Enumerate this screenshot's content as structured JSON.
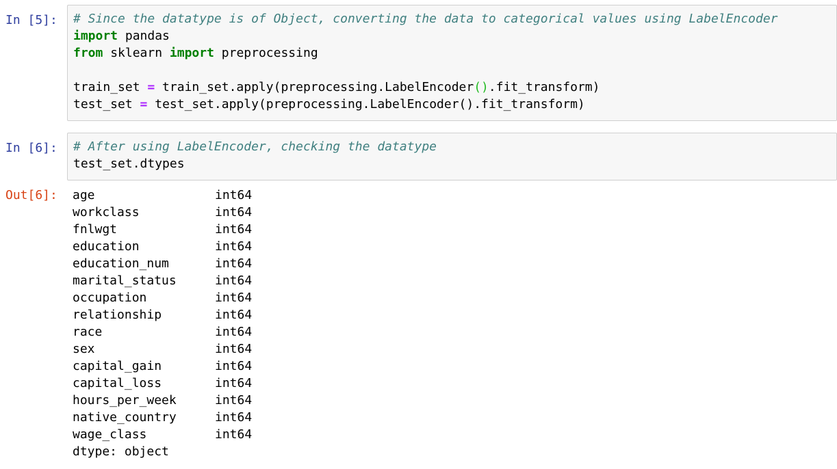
{
  "cells": [
    {
      "prompt": "In [5]:",
      "lines": [
        [
          {
            "t": "cm",
            "v": "# Since the datatype is of Object, converting the data to categorical values using LabelEncoder"
          }
        ],
        [
          {
            "t": "kw",
            "v": "import"
          },
          {
            "t": "",
            "v": " pandas"
          }
        ],
        [
          {
            "t": "kw",
            "v": "from"
          },
          {
            "t": "",
            "v": " sklearn "
          },
          {
            "t": "kw",
            "v": "import"
          },
          {
            "t": "",
            "v": " preprocessing"
          }
        ],
        [
          {
            "t": "",
            "v": ""
          }
        ],
        [
          {
            "t": "",
            "v": "train_set "
          },
          {
            "t": "op",
            "v": "="
          },
          {
            "t": "",
            "v": " train_set.apply(preprocessing.LabelEncoder"
          },
          {
            "t": "paren-match",
            "v": "()"
          },
          {
            "t": "",
            "v": ".fit_transform)"
          }
        ],
        [
          {
            "t": "",
            "v": "test_set "
          },
          {
            "t": "op",
            "v": "="
          },
          {
            "t": "",
            "v": " test_set.apply(preprocessing.LabelEncoder().fit_transform)"
          }
        ]
      ]
    },
    {
      "prompt": "In [6]:",
      "lines": [
        [
          {
            "t": "cm",
            "v": "# After using LabelEncoder, checking the datatype"
          }
        ],
        [
          {
            "t": "",
            "v": "test_set.dtypes"
          }
        ]
      ]
    }
  ],
  "output": {
    "prompt": "Out[6]:",
    "rows": [
      {
        "name": "age",
        "dtype": "int64"
      },
      {
        "name": "workclass",
        "dtype": "int64"
      },
      {
        "name": "fnlwgt",
        "dtype": "int64"
      },
      {
        "name": "education",
        "dtype": "int64"
      },
      {
        "name": "education_num",
        "dtype": "int64"
      },
      {
        "name": "marital_status",
        "dtype": "int64"
      },
      {
        "name": "occupation",
        "dtype": "int64"
      },
      {
        "name": "relationship",
        "dtype": "int64"
      },
      {
        "name": "race",
        "dtype": "int64"
      },
      {
        "name": "sex",
        "dtype": "int64"
      },
      {
        "name": "capital_gain",
        "dtype": "int64"
      },
      {
        "name": "capital_loss",
        "dtype": "int64"
      },
      {
        "name": "hours_per_week",
        "dtype": "int64"
      },
      {
        "name": "native_country",
        "dtype": "int64"
      },
      {
        "name": "wage_class",
        "dtype": "int64"
      }
    ],
    "footer": "dtype: object"
  },
  "colors": {
    "prompt_in": "#303f9f",
    "prompt_out": "#d84315",
    "comment": "#408080",
    "keyword": "#008000",
    "operator": "#aa22ff",
    "cell_background": "#f7f7f7",
    "cell_border": "#cfcfcf"
  }
}
